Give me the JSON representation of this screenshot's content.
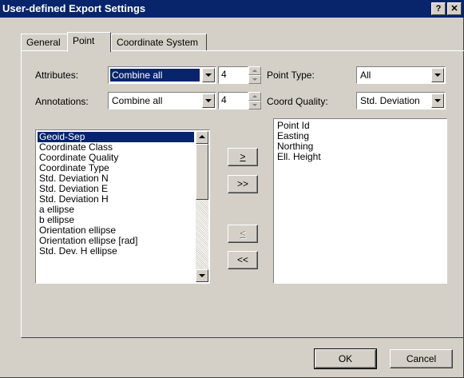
{
  "window": {
    "title": "User-defined Export Settings",
    "help_label": "?",
    "close_label": "✕"
  },
  "tabs": [
    {
      "label": "General"
    },
    {
      "label": "Point"
    },
    {
      "label": "Coordinate System"
    }
  ],
  "attributes": {
    "label": "Attributes:",
    "value": "Combine all",
    "count": "4"
  },
  "annotations": {
    "label": "Annotations:",
    "value": "Combine all",
    "count": "4"
  },
  "point_type": {
    "label": "Point Type:",
    "value": "All"
  },
  "coord_quality": {
    "label": "Coord Quality:",
    "value": "Std. Deviation"
  },
  "available_list": {
    "items": [
      "Geoid-Sep",
      "Coordinate Class",
      "Coordinate Quality",
      "Coordinate Type",
      "Std. Deviation N",
      "Std. Deviation E",
      "Std. Deviation H",
      "a ellipse",
      "b ellipse",
      "Orientation ellipse",
      "Orientation ellipse [rad]",
      "Std. Dev. H ellipse"
    ],
    "selected_index": 0
  },
  "selected_list": {
    "items": [
      "Point Id",
      "Easting",
      "Northing",
      "Ell. Height"
    ]
  },
  "transfer_buttons": {
    "add": ">",
    "add_all": ">>",
    "remove": "<",
    "remove_all": "<<"
  },
  "footer": {
    "ok_label": "OK",
    "cancel_label": "Cancel"
  },
  "colors": {
    "title_bar": "#08246b",
    "face": "#d4d0c8",
    "selection": "#08246b"
  }
}
